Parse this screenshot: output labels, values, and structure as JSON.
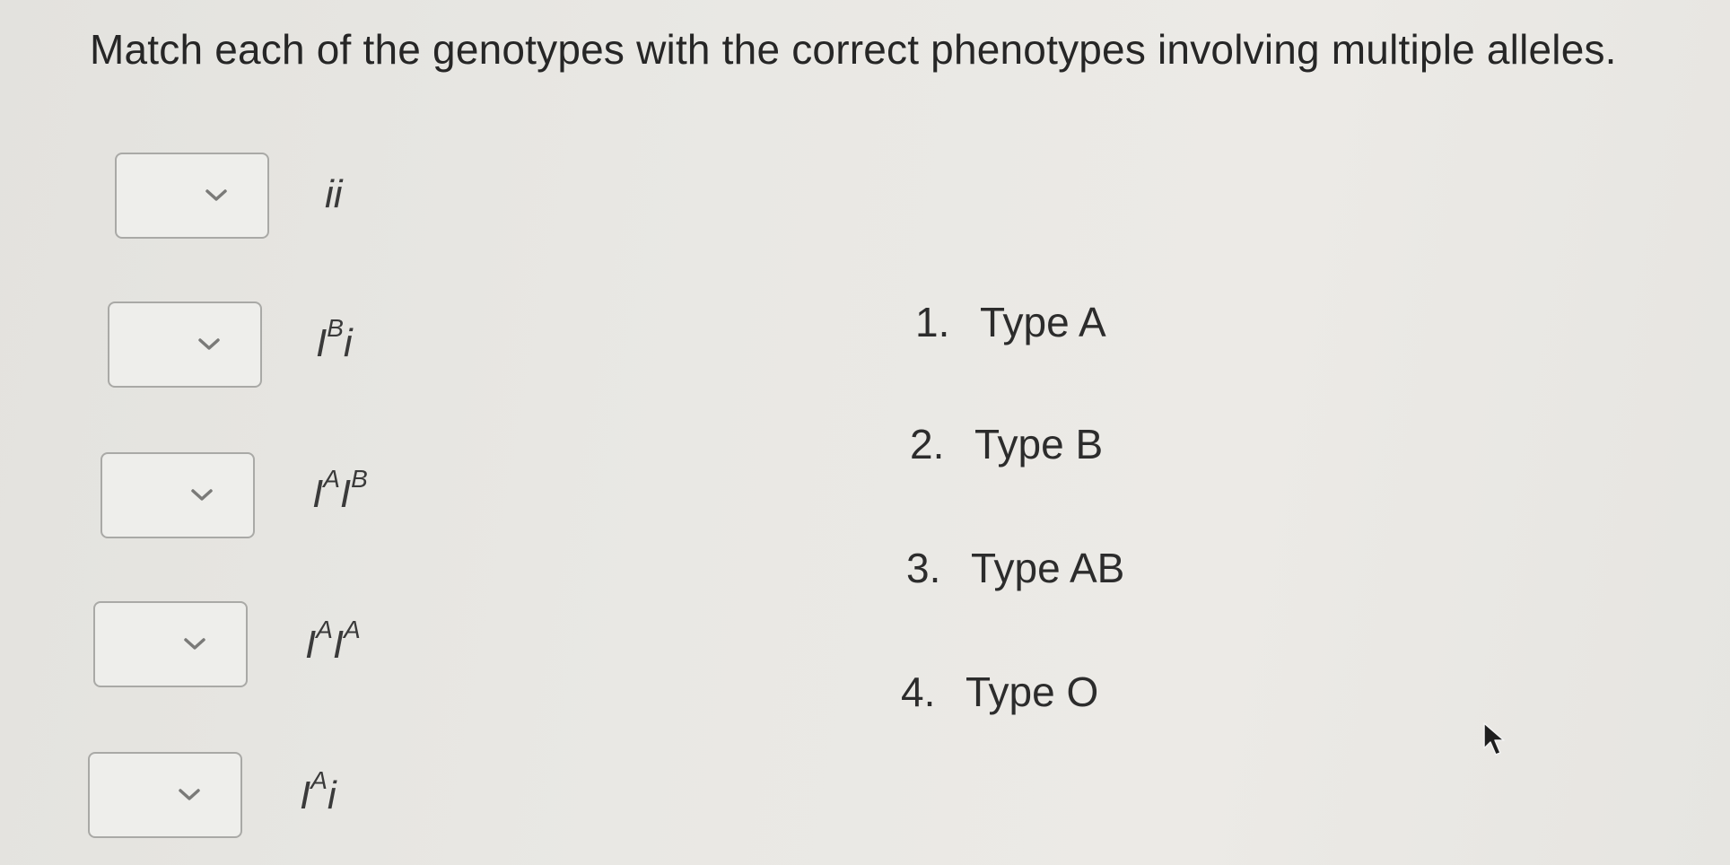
{
  "question": "Match each of the genotypes with the correct phenotypes involving multiple alleles.",
  "rows": [
    {
      "genotype": {
        "base1": "",
        "sup1": "",
        "base2": "ii",
        "sup2": "",
        "tail": ""
      },
      "selected": ""
    },
    {
      "genotype": {
        "base1": "I",
        "sup1": "B",
        "base2": "i",
        "sup2": "",
        "tail": ""
      },
      "selected": ""
    },
    {
      "genotype": {
        "base1": "I",
        "sup1": "A",
        "base2": "I",
        "sup2": "B",
        "tail": ""
      },
      "selected": ""
    },
    {
      "genotype": {
        "base1": "I",
        "sup1": "A",
        "base2": "I",
        "sup2": "A",
        "tail": ""
      },
      "selected": ""
    },
    {
      "genotype": {
        "base1": "I",
        "sup1": "A",
        "base2": "i",
        "sup2": "",
        "tail": ""
      },
      "selected": ""
    }
  ],
  "answers": [
    {
      "num": "1.",
      "label": "Type A"
    },
    {
      "num": "2.",
      "label": "Type B"
    },
    {
      "num": "3.",
      "label": "Type AB"
    },
    {
      "num": "4.",
      "label": "Type O"
    }
  ],
  "icons": {
    "dropdown": "chevron-down-icon",
    "cursor": "mouse-pointer-icon"
  },
  "colors": {
    "text": "#2a2a2a",
    "dropdown_border": "#a9a9a6",
    "dropdown_fill": "#eeeeeb"
  }
}
